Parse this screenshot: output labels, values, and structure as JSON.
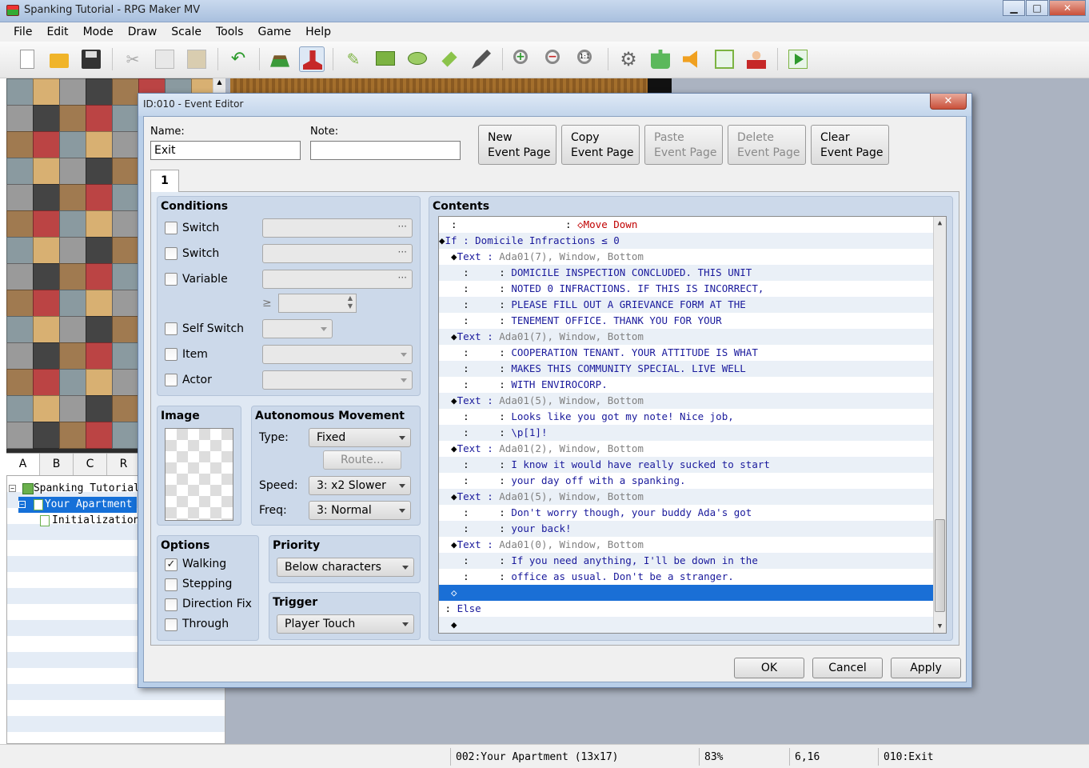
{
  "window": {
    "title": "Spanking Tutorial - RPG Maker MV",
    "minimize": "▁",
    "maximize": "□",
    "close": "✕"
  },
  "menu": [
    "File",
    "Edit",
    "Mode",
    "Draw",
    "Scale",
    "Tools",
    "Game",
    "Help"
  ],
  "toolbar": [
    "new-project-icon",
    "open-project-icon",
    "save-project-icon",
    "cut-icon",
    "copy-icon",
    "paste-icon",
    "undo-icon",
    "map-mode-icon",
    "event-mode-icon",
    "pencil-icon",
    "rectangle-icon",
    "ellipse-icon",
    "fill-icon",
    "shadow-pen-icon",
    "zoom-in-icon",
    "zoom-out-icon",
    "actual-size-icon",
    "database-icon",
    "plugin-manager-icon",
    "sound-test-icon",
    "event-searcher-icon",
    "character-generator-icon",
    "playtest-icon"
  ],
  "tileset_tabs": [
    "A",
    "B",
    "C",
    "R"
  ],
  "map_tree": [
    {
      "label": "Spanking Tutorial",
      "level": 0
    },
    {
      "label": "Your Apartment",
      "level": 1,
      "selected": true
    },
    {
      "label": "Initialization",
      "level": 2
    }
  ],
  "status": {
    "map": "002:Your Apartment (13x17)",
    "zoom": "83%",
    "coords": "6,16",
    "event": "010:Exit"
  },
  "dialog": {
    "title": "ID:010 - Event Editor",
    "close": "✕",
    "name_label": "Name:",
    "name_value": "Exit",
    "note_label": "Note:",
    "note_value": "",
    "page_buttons": [
      {
        "line1": "New",
        "line2": "Event Page",
        "enabled": true
      },
      {
        "line1": "Copy",
        "line2": "Event Page",
        "enabled": true
      },
      {
        "line1": "Paste",
        "line2": "Event Page",
        "enabled": false
      },
      {
        "line1": "Delete",
        "line2": "Event Page",
        "enabled": false
      },
      {
        "line1": "Clear",
        "line2": "Event Page",
        "enabled": true
      }
    ],
    "page_tab": "1",
    "conditions": {
      "title": "Conditions",
      "switch1": "Switch",
      "switch2": "Switch",
      "variable": "Variable",
      "ge": "≥",
      "self_switch": "Self Switch",
      "item": "Item",
      "actor": "Actor",
      "dots": "···"
    },
    "image": {
      "title": "Image"
    },
    "autonomous": {
      "title": "Autonomous Movement",
      "type_label": "Type:",
      "type_value": "Fixed",
      "route": "Route...",
      "speed_label": "Speed:",
      "speed_value": "3: x2 Slower",
      "freq_label": "Freq:",
      "freq_value": "3: Normal"
    },
    "options": {
      "title": "Options",
      "walking": "Walking",
      "walking_checked": "✓",
      "stepping": "Stepping",
      "direction_fix": "Direction Fix",
      "through": "Through"
    },
    "priority": {
      "title": "Priority",
      "value": "Below characters"
    },
    "trigger": {
      "title": "Trigger",
      "value": "Player Touch"
    },
    "contents": {
      "title": "Contents",
      "rows": [
        {
          "pre": "  :                  : ",
          "cmd": "",
          "rest": "",
          "red": "◇Move Down"
        },
        {
          "pre": "◆",
          "cmd": "If : Domicile Infractions ≤ 0",
          "rest": "",
          "red": ""
        },
        {
          "pre": "  ◆",
          "cmd": "Text : ",
          "rest": "Ada01(7), Window, Bottom",
          "red": ""
        },
        {
          "pre": "    :     : ",
          "cmd": "DOMICILE INSPECTION CONCLUDED. THIS UNIT",
          "rest": "",
          "red": ""
        },
        {
          "pre": "    :     : ",
          "cmd": "NOTED 0 INFRACTIONS. IF THIS IS INCORRECT,",
          "rest": "",
          "red": ""
        },
        {
          "pre": "    :     : ",
          "cmd": "PLEASE FILL OUT A GRIEVANCE FORM AT THE",
          "rest": "",
          "red": ""
        },
        {
          "pre": "    :     : ",
          "cmd": "TENEMENT OFFICE. THANK YOU FOR YOUR",
          "rest": "",
          "red": ""
        },
        {
          "pre": "  ◆",
          "cmd": "Text : ",
          "rest": "Ada01(7), Window, Bottom",
          "red": ""
        },
        {
          "pre": "    :     : ",
          "cmd": "COOPERATION TENANT. YOUR ATTITUDE IS WHAT",
          "rest": "",
          "red": ""
        },
        {
          "pre": "    :     : ",
          "cmd": "MAKES THIS COMMUNITY SPECIAL. LIVE WELL",
          "rest": "",
          "red": ""
        },
        {
          "pre": "    :     : ",
          "cmd": "WITH ENVIROCORP.",
          "rest": "",
          "red": ""
        },
        {
          "pre": "  ◆",
          "cmd": "Text : ",
          "rest": "Ada01(5), Window, Bottom",
          "red": ""
        },
        {
          "pre": "    :     : ",
          "cmd": "Looks like you got my note! Nice job,",
          "rest": "",
          "red": ""
        },
        {
          "pre": "    :     : ",
          "cmd": "\\p[1]!",
          "rest": "",
          "red": ""
        },
        {
          "pre": "  ◆",
          "cmd": "Text : ",
          "rest": "Ada01(2), Window, Bottom",
          "red": ""
        },
        {
          "pre": "    :     : ",
          "cmd": "I know it would have really sucked to start",
          "rest": "",
          "red": ""
        },
        {
          "pre": "    :     : ",
          "cmd": "your day off with a spanking.",
          "rest": "",
          "red": ""
        },
        {
          "pre": "  ◆",
          "cmd": "Text : ",
          "rest": "Ada01(5), Window, Bottom",
          "red": ""
        },
        {
          "pre": "    :     : ",
          "cmd": "Don't worry though, your buddy Ada's got",
          "rest": "",
          "red": ""
        },
        {
          "pre": "    :     : ",
          "cmd": "your back!",
          "rest": "",
          "red": ""
        },
        {
          "pre": "  ◆",
          "cmd": "Text : ",
          "rest": "Ada01(0), Window, Bottom",
          "red": ""
        },
        {
          "pre": "    :     : ",
          "cmd": "If you need anything, I'll be down in the",
          "rest": "",
          "red": ""
        },
        {
          "pre": "    :     : ",
          "cmd": "office as usual. Don't be a stranger.",
          "rest": "",
          "red": ""
        },
        {
          "pre": "  ◇",
          "cmd": "",
          "rest": "",
          "red": "",
          "selected": true
        },
        {
          "pre": " : ",
          "cmd": "Else",
          "rest": "",
          "red": ""
        },
        {
          "pre": "  ◆",
          "cmd": "",
          "rest": "",
          "red": ""
        }
      ],
      "scroll_up": "▲",
      "scroll_down": "▼"
    },
    "buttons": {
      "ok": "OK",
      "cancel": "Cancel",
      "apply": "Apply"
    }
  },
  "colors": {
    "accent": "#1a6fd6",
    "command_text": "#1a1a9c",
    "dialog_frame": "#b9cfe9",
    "group_bg": "#ccd9ea"
  }
}
